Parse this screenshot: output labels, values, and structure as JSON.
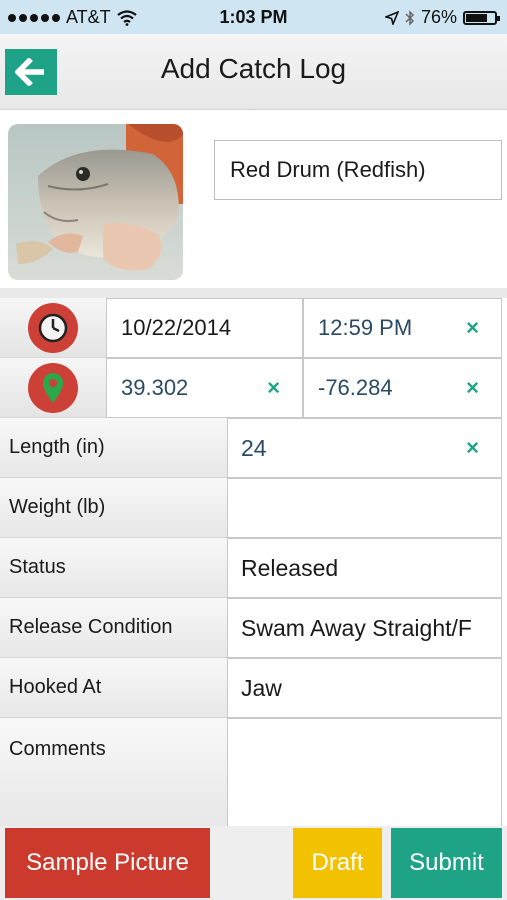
{
  "status_bar": {
    "carrier": "AT&T",
    "time": "1:03 PM",
    "battery_text": "76%",
    "battery_level": 0.76
  },
  "header": {
    "back_icon": "arrow-left-icon",
    "title": "Add Catch Log"
  },
  "species": {
    "value": "Red Drum (Redfish)"
  },
  "datetime": {
    "icon": "clock-icon",
    "date": "10/22/2014",
    "time": "12:59 PM",
    "clear_glyph": "×"
  },
  "location": {
    "icon": "map-pin-icon",
    "latitude": "39.302",
    "longitude": "-76.284",
    "clear_glyph": "×"
  },
  "form": {
    "length": {
      "label": "Length (in)",
      "value": "24",
      "clear_glyph": "×"
    },
    "weight": {
      "label": "Weight (lb)",
      "value": ""
    },
    "status": {
      "label": "Status",
      "value": "Released"
    },
    "release_condition": {
      "label": "Release Condition",
      "value": "Swam Away Straight/F"
    },
    "hooked_at": {
      "label": "Hooked At",
      "value": "Jaw"
    },
    "comments": {
      "label": "Comments",
      "value": ""
    }
  },
  "buttons": {
    "sample_picture": "Sample Picture",
    "draft": "Draft",
    "submit": "Submit"
  },
  "colors": {
    "accent_green": "#1fa386",
    "red": "#cc3a2e",
    "yellow": "#f2c200"
  }
}
